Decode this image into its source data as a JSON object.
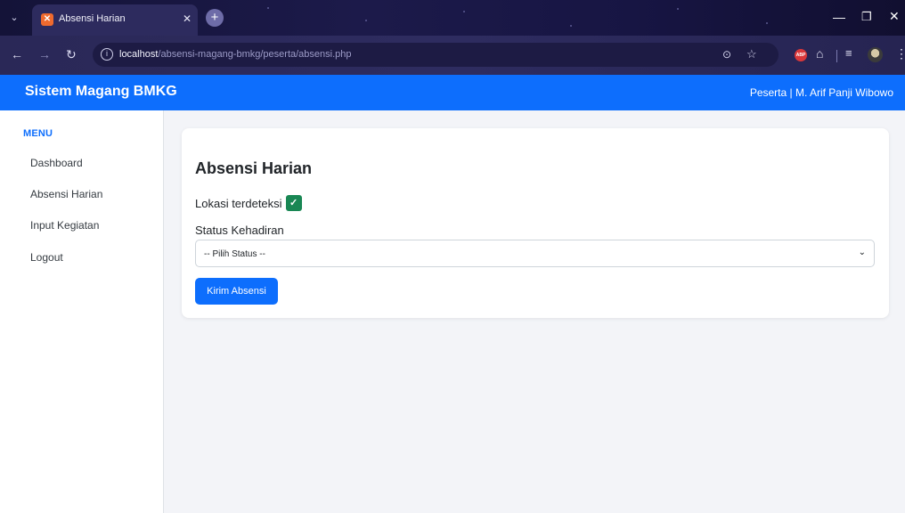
{
  "browser": {
    "tab": {
      "title": "Absensi Harian",
      "favicon": "xampp-favicon-icon"
    },
    "address": {
      "host": "localhost",
      "path": "/absensi-magang-bmkg/peserta/absensi.php"
    },
    "extensions": {
      "abp_label": "ABP"
    }
  },
  "navbar": {
    "brand": "Sistem Magang BMKG",
    "user_info": "Peserta | M. Arif Panji Wibowo",
    "color": "#0d6efd"
  },
  "sidebar": {
    "heading": "MENU",
    "items": [
      {
        "label": "Dashboard"
      },
      {
        "label": "Absensi Harian"
      },
      {
        "label": "Input Kegiatan"
      },
      {
        "label": "Logout"
      }
    ]
  },
  "main": {
    "title": "Absensi Harian",
    "location_text": "Lokasi terdeteksi",
    "location_check": "✓",
    "status_label": "Status Kehadiran",
    "status_select_value": "-- Pilih Status --",
    "submit_label": "Kirim Absensi"
  }
}
